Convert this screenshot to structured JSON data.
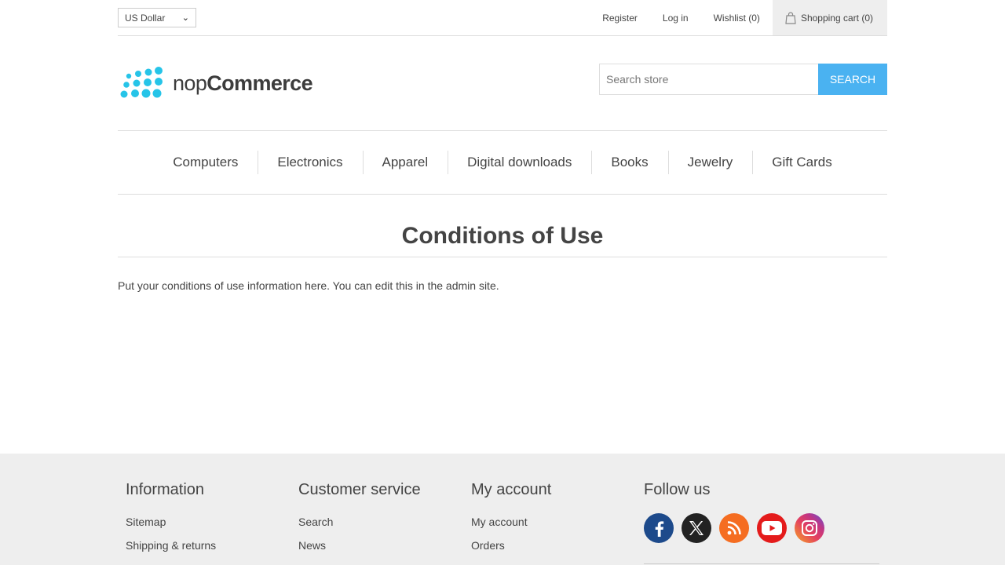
{
  "header": {
    "currency": "US Dollar",
    "links": {
      "register": "Register",
      "login": "Log in",
      "wishlist": "Wishlist (0)",
      "cart": "Shopping cart (0)"
    }
  },
  "logo": {
    "prefix": "nop",
    "suffix": "Commerce"
  },
  "search": {
    "placeholder": "Search store",
    "button": "SEARCH"
  },
  "menu": [
    "Computers",
    "Electronics",
    "Apparel",
    "Digital downloads",
    "Books",
    "Jewelry",
    "Gift Cards"
  ],
  "page": {
    "title": "Conditions of Use",
    "body": "Put your conditions of use information here. You can edit this in the admin site."
  },
  "footer": {
    "information": {
      "title": "Information",
      "links": [
        "Sitemap",
        "Shipping & returns"
      ]
    },
    "customer_service": {
      "title": "Customer service",
      "links": [
        "Search",
        "News"
      ]
    },
    "my_account": {
      "title": "My account",
      "links": [
        "My account",
        "Orders"
      ]
    },
    "follow_us": {
      "title": "Follow us",
      "icons": [
        "facebook-icon",
        "x-icon",
        "rss-icon",
        "youtube-icon",
        "instagram-icon"
      ]
    }
  },
  "colors": {
    "accent": "#4ab2f1",
    "logo_dots": "#26c4e8",
    "footer_bg": "#eeeeee"
  }
}
